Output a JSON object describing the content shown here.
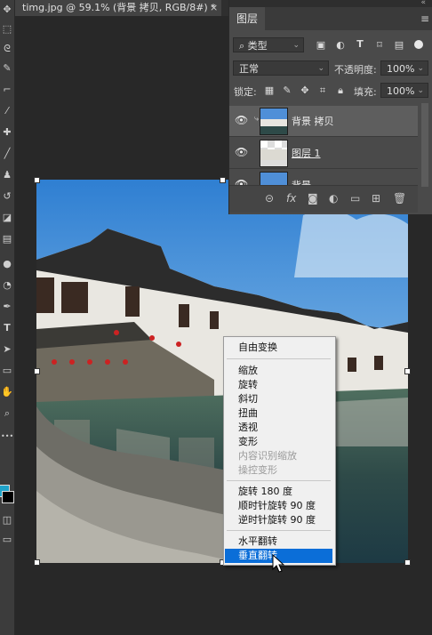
{
  "document": {
    "tab_title": "timg.jpg @ 59.1% (背景 拷贝, RGB/8#) *",
    "close_glyph": "×"
  },
  "toolbar": {
    "tools": [
      "move-icon",
      "marquee-icon",
      "lasso-icon",
      "quick-select-icon",
      "crop-icon",
      "eyedropper-icon",
      "healing-brush-icon",
      "brush-icon",
      "clone-stamp-icon",
      "history-brush-icon",
      "eraser-icon",
      "gradient-icon",
      "blur-icon",
      "dodge-icon",
      "pen-icon",
      "type-icon",
      "path-select-icon",
      "shape-icon",
      "hand-icon",
      "zoom-icon",
      "more-tools-icon"
    ],
    "type_glyph": "T",
    "more_glyph": "•••",
    "fg_color": "#1fa3c9",
    "bg_color": "#000000"
  },
  "layers_panel": {
    "title": "图层",
    "filter_kind": "类型",
    "blend_mode": "正常",
    "opacity_label": "不透明度:",
    "opacity_value": "100%",
    "lock_label": "锁定:",
    "fill_label": "填充:",
    "fill_value": "100%",
    "layers": [
      {
        "name": "背景 拷贝",
        "visible": true,
        "selected": true
      },
      {
        "name": "图层 1",
        "visible": true,
        "selected": false
      },
      {
        "name": "背景",
        "visible": true,
        "selected": false
      }
    ],
    "bottom_icons": [
      "link-icon",
      "fx-icon",
      "mask-icon",
      "adjustment-icon",
      "group-icon",
      "new-layer-icon",
      "trash-icon"
    ],
    "fx_text": "fx"
  },
  "context_menu": {
    "items": [
      {
        "label": "自由变换",
        "enabled": true
      },
      {
        "label": "缩放",
        "enabled": true
      },
      {
        "label": "旋转",
        "enabled": true
      },
      {
        "label": "斜切",
        "enabled": true
      },
      {
        "label": "扭曲",
        "enabled": true
      },
      {
        "label": "透视",
        "enabled": true
      },
      {
        "label": "变形",
        "enabled": true
      },
      {
        "label": "内容识别缩放",
        "enabled": false
      },
      {
        "label": "操控变形",
        "enabled": false
      },
      {
        "label": "旋转 180 度",
        "enabled": true
      },
      {
        "label": "顺时针旋转 90 度",
        "enabled": true
      },
      {
        "label": "逆时针旋转 90 度",
        "enabled": true
      },
      {
        "label": "水平翻转",
        "enabled": true
      },
      {
        "label": "垂直翻转",
        "enabled": true,
        "highlighted": true
      }
    ]
  },
  "colors": {
    "accent": "#0b6ed8",
    "panel_bg": "#4a4a4a",
    "canvas_bg": "#282828"
  }
}
